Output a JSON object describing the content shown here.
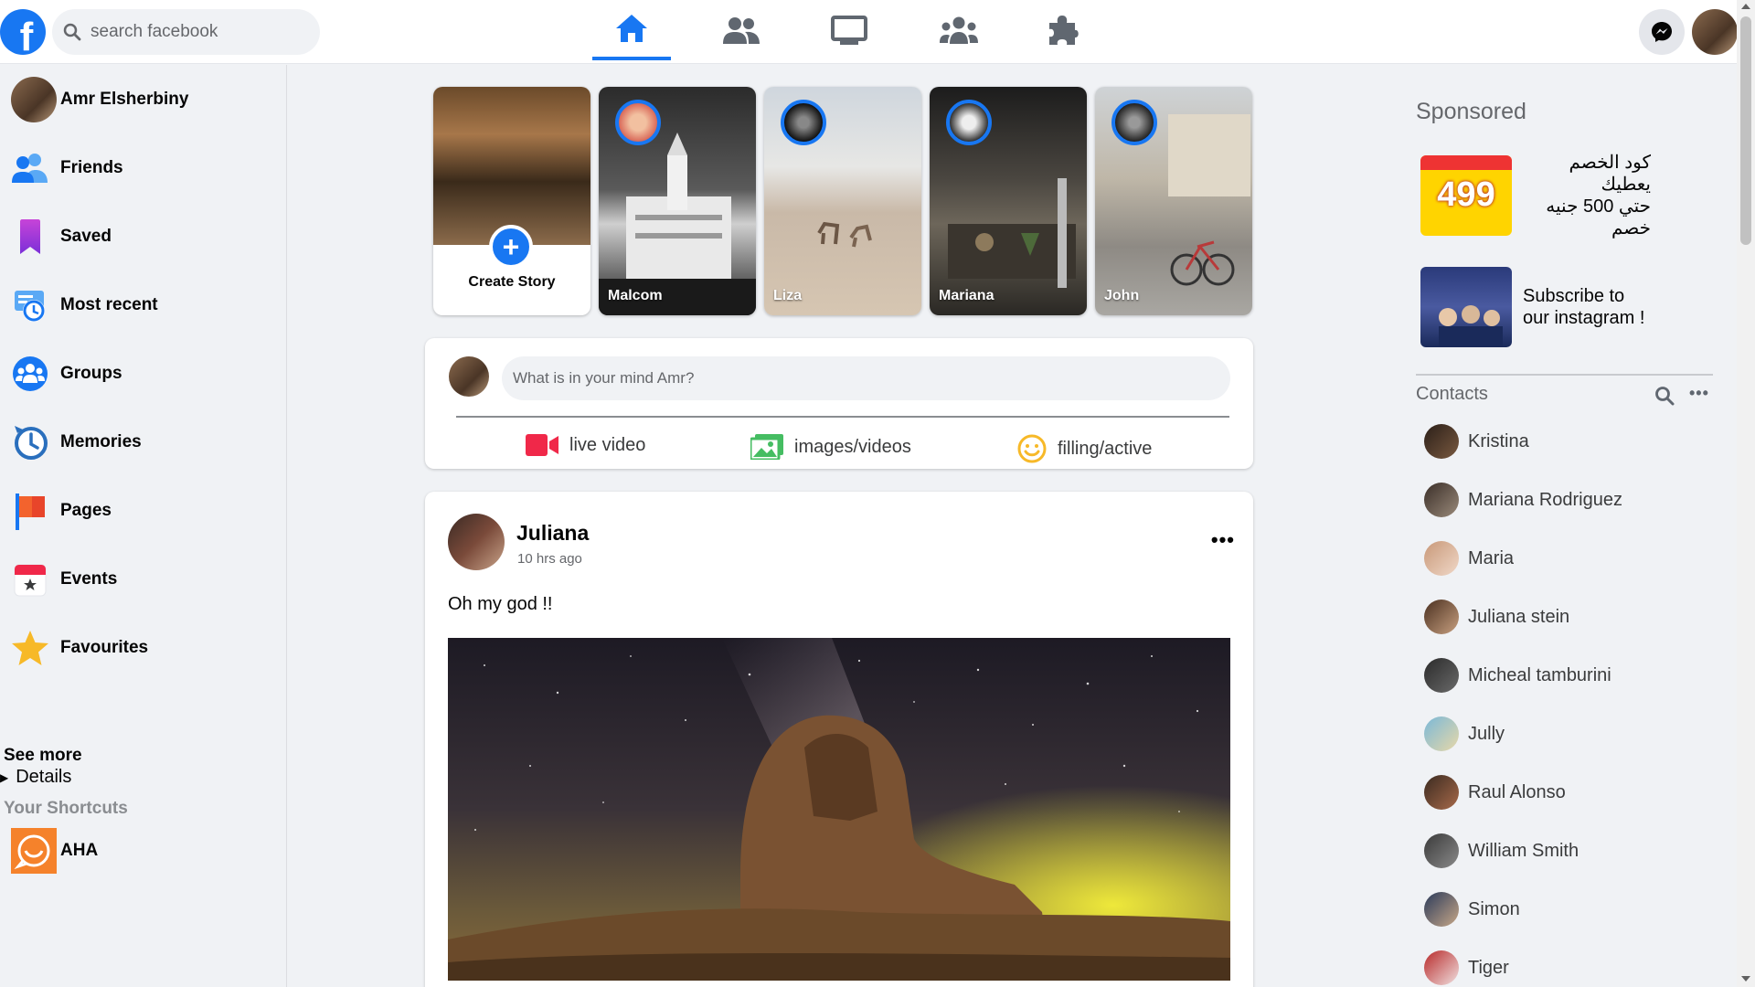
{
  "topbar": {
    "logo_letter": "f",
    "search_placeholder": "search facebook",
    "tabs": [
      "home",
      "friends",
      "watch",
      "groups",
      "gaming"
    ],
    "active_tab": "home"
  },
  "user": {
    "name": "Amr Elsherbiny"
  },
  "sidebar": {
    "items": [
      {
        "label": "Friends",
        "icon": "friends-icon"
      },
      {
        "label": "Saved",
        "icon": "bookmark-icon"
      },
      {
        "label": "Most recent",
        "icon": "clock-feed-icon"
      },
      {
        "label": "Groups",
        "icon": "groups-icon"
      },
      {
        "label": "Memories",
        "icon": "memories-clock-icon"
      },
      {
        "label": "Pages",
        "icon": "flag-icon"
      },
      {
        "label": "Events",
        "icon": "calendar-icon"
      },
      {
        "label": "Favourites",
        "icon": "star-icon"
      }
    ],
    "see_more": "See more",
    "details": "Details",
    "shortcuts_title": "Your Shortcuts",
    "shortcuts": [
      {
        "label": "AHA",
        "icon": "aha-icon"
      }
    ]
  },
  "stories": {
    "create_label": "Create Story",
    "items": [
      {
        "name": "Malcom"
      },
      {
        "name": "Liza"
      },
      {
        "name": "Mariana"
      },
      {
        "name": "John"
      }
    ]
  },
  "composer": {
    "placeholder": "What is in your mind Amr?",
    "actions": [
      {
        "label": "live video",
        "icon": "video-camera-icon",
        "color": "#f02849"
      },
      {
        "label": "images/videos",
        "icon": "photo-icon",
        "color": "#45bd62"
      },
      {
        "label": "filling/active",
        "icon": "smiley-icon",
        "color": "#f7b928"
      }
    ]
  },
  "post": {
    "author": "Juliana",
    "time": "10 hrs ago",
    "text": "Oh my god !!",
    "more": "•••"
  },
  "right": {
    "sponsored_title": "Sponsored",
    "ads": [
      {
        "text_line1": "كود الخصم يعطيك",
        "text_line2": "حتي 500 جنيه خصم",
        "badge": "499"
      },
      {
        "text_line1": "Subscribe to",
        "text_line2": "our instagram !"
      }
    ],
    "contacts_title": "Contacts",
    "contacts": [
      "Kristina",
      "Mariana Rodriguez",
      "Maria",
      "Juliana stein",
      "Micheal tamburini",
      "Jully",
      "Raul Alonso",
      "William Smith",
      "Simon",
      "Tiger"
    ]
  },
  "colors": {
    "brand": "#1877f2",
    "background": "#f0f2f5"
  }
}
